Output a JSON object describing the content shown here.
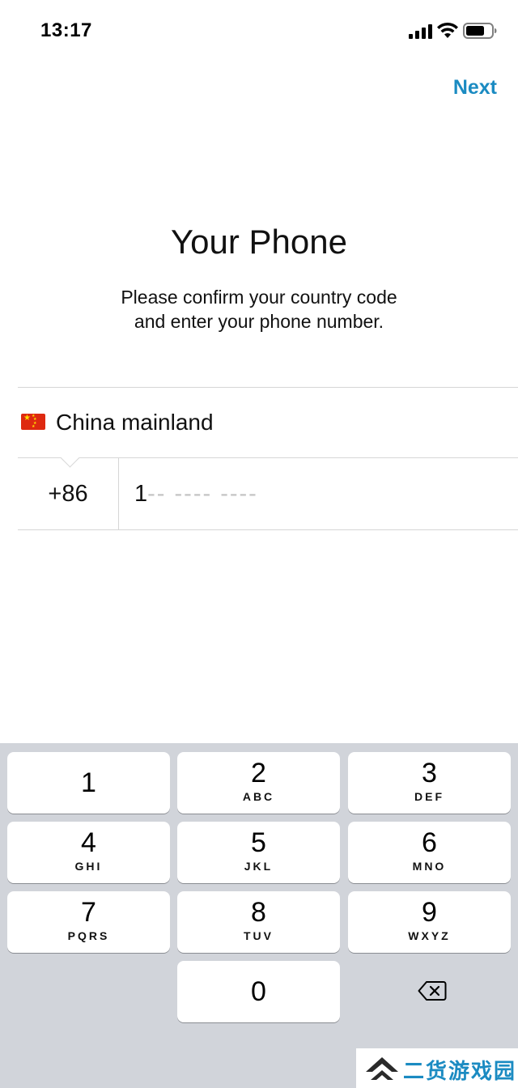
{
  "status_bar": {
    "time": "13:17"
  },
  "header": {
    "next_label": "Next"
  },
  "main": {
    "title": "Your Phone",
    "subtitle_line1": "Please confirm your country code",
    "subtitle_line2": "and enter your phone number."
  },
  "country": {
    "flag": "china-flag-icon",
    "name": "China mainland"
  },
  "phone": {
    "code": "+86",
    "value": "1",
    "mask": "-- ---- ----"
  },
  "keyboard": {
    "keys": [
      {
        "digit": "1",
        "letters": ""
      },
      {
        "digit": "2",
        "letters": "ABC"
      },
      {
        "digit": "3",
        "letters": "DEF"
      },
      {
        "digit": "4",
        "letters": "GHI"
      },
      {
        "digit": "5",
        "letters": "JKL"
      },
      {
        "digit": "6",
        "letters": "MNO"
      },
      {
        "digit": "7",
        "letters": "PQRS"
      },
      {
        "digit": "8",
        "letters": "TUV"
      },
      {
        "digit": "9",
        "letters": "WXYZ"
      },
      {
        "digit": "0",
        "letters": ""
      }
    ],
    "delete_icon": "backspace-icon"
  },
  "watermark": {
    "text": "二货游戏园"
  },
  "colors": {
    "accent": "#1b8bc2",
    "keyboard_bg": "#d1d4da",
    "divider": "#d6d6d6",
    "flag_red": "#de2910",
    "flag_yellow": "#ffde00"
  }
}
